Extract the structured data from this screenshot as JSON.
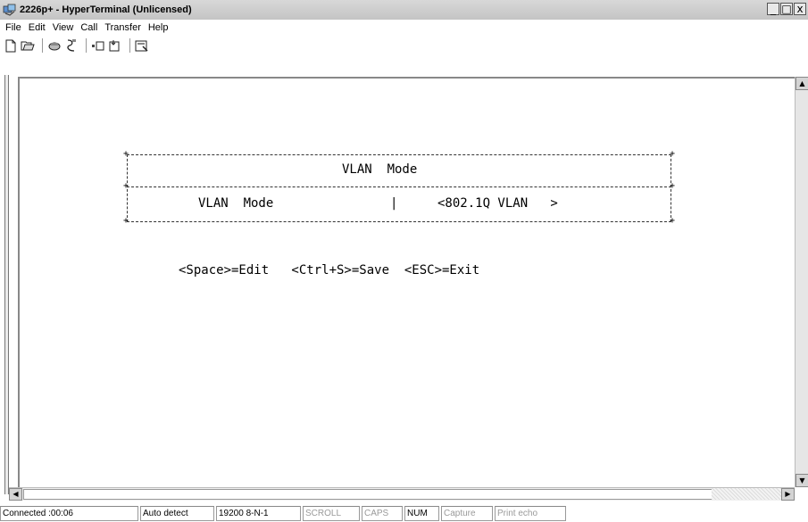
{
  "window": {
    "title": "2226p+ - HyperTerminal (Unlicensed)",
    "controls": {
      "minimize": "_",
      "maximize": "□",
      "close": "x"
    }
  },
  "menu": [
    {
      "label": "File"
    },
    {
      "label": "Edit"
    },
    {
      "label": "View"
    },
    {
      "label": "Call"
    },
    {
      "label": "Transfer"
    },
    {
      "label": "Help"
    }
  ],
  "toolbar": {
    "icons": [
      "new-icon",
      "open-icon",
      "connect-icon",
      "disconnect-icon",
      "send-icon",
      "receive-icon",
      "properties-icon"
    ]
  },
  "terminal": {
    "panel_title": "VLAN  Mode",
    "field_label": "VLAN  Mode",
    "field_separator": "|",
    "field_value": "<802.1Q VLAN   >",
    "help_line": "<Space>=Edit   <Ctrl+S>=Save  <ESC>=Exit"
  },
  "status": {
    "connected": "Connected :00:06",
    "detect": "Auto detect",
    "settings": "19200 8-N-1",
    "scroll": "SCROLL",
    "caps": "CAPS",
    "num": "NUM",
    "capture": "Capture",
    "print_echo": "Print echo"
  }
}
